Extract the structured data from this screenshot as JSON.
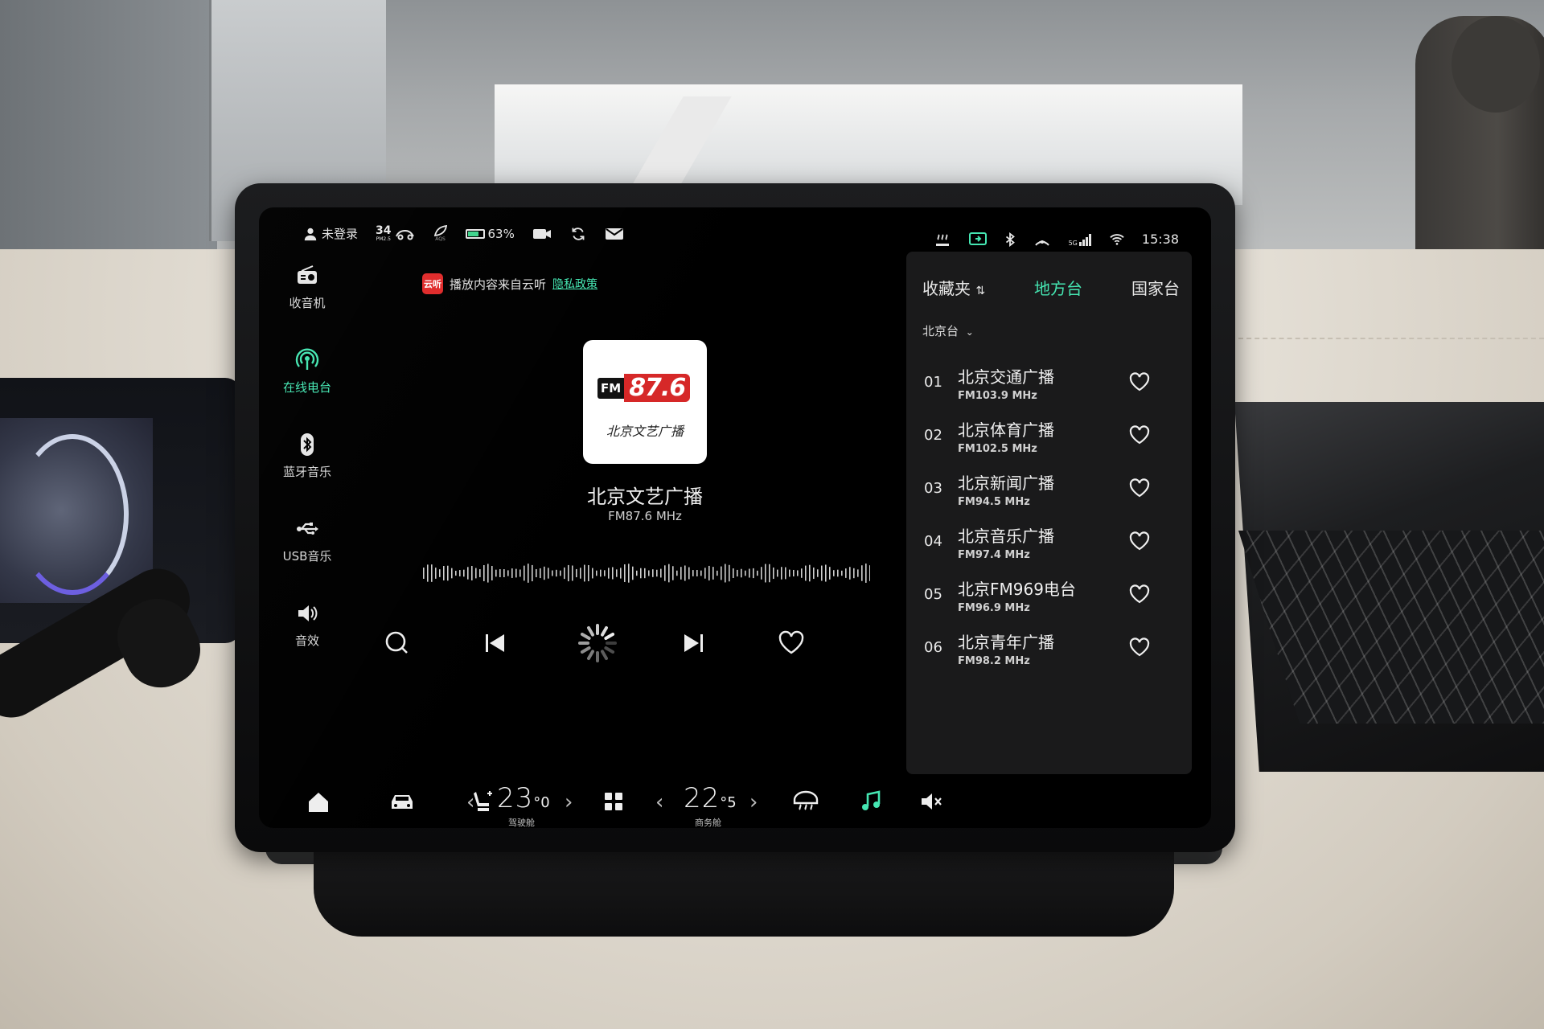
{
  "status": {
    "login": "未登录",
    "aqi_value": "34",
    "aqi_label": "PM2.5",
    "aqs_label": "AQS",
    "battery": "63%",
    "battery_level": 0.63,
    "time": "15:38",
    "signal_label": "5G"
  },
  "nav": {
    "items": [
      {
        "label": "收音机",
        "icon": "radio-icon"
      },
      {
        "label": "在线电台",
        "icon": "online-radio-icon",
        "active": true
      },
      {
        "label": "蓝牙音乐",
        "icon": "bluetooth-icon"
      },
      {
        "label": "USB音乐",
        "icon": "usb-icon"
      },
      {
        "label": "音效",
        "icon": "speaker-icon"
      }
    ]
  },
  "notice": {
    "source_logo": "云听",
    "text": "播放内容来自云听",
    "link": "隐私政策"
  },
  "now_playing": {
    "cover_fm": "FM",
    "cover_freq": "87.6",
    "cover_calligraphy": "北京文艺广播",
    "name": "北京文艺广播",
    "frequency": "FM87.6 MHz"
  },
  "list": {
    "tabs": [
      {
        "label": "收藏夹",
        "active": false
      },
      {
        "label": "地方台",
        "active": true
      },
      {
        "label": "国家台",
        "active": false
      }
    ],
    "region": "北京台",
    "stations": [
      {
        "num": "01",
        "name": "北京交通广播",
        "freq": "FM103.9 MHz"
      },
      {
        "num": "02",
        "name": "北京体育广播",
        "freq": "FM102.5 MHz"
      },
      {
        "num": "03",
        "name": "北京新闻广播",
        "freq": "FM94.5 MHz"
      },
      {
        "num": "04",
        "name": "北京音乐广播",
        "freq": "FM97.4 MHz"
      },
      {
        "num": "05",
        "name": "北京FM969电台",
        "freq": "FM96.9 MHz"
      },
      {
        "num": "06",
        "name": "北京青年广播",
        "freq": "FM98.2 MHz"
      }
    ]
  },
  "climate": {
    "driver_temp_int": "23",
    "driver_temp_dec": "0",
    "driver_label": "驾驶舱",
    "rear_temp_int": "22",
    "rear_temp_dec": "5",
    "rear_label": "商务舱"
  },
  "colors": {
    "accent": "#45e6b2",
    "background": "#000000",
    "panel": "#1a1a1b"
  }
}
